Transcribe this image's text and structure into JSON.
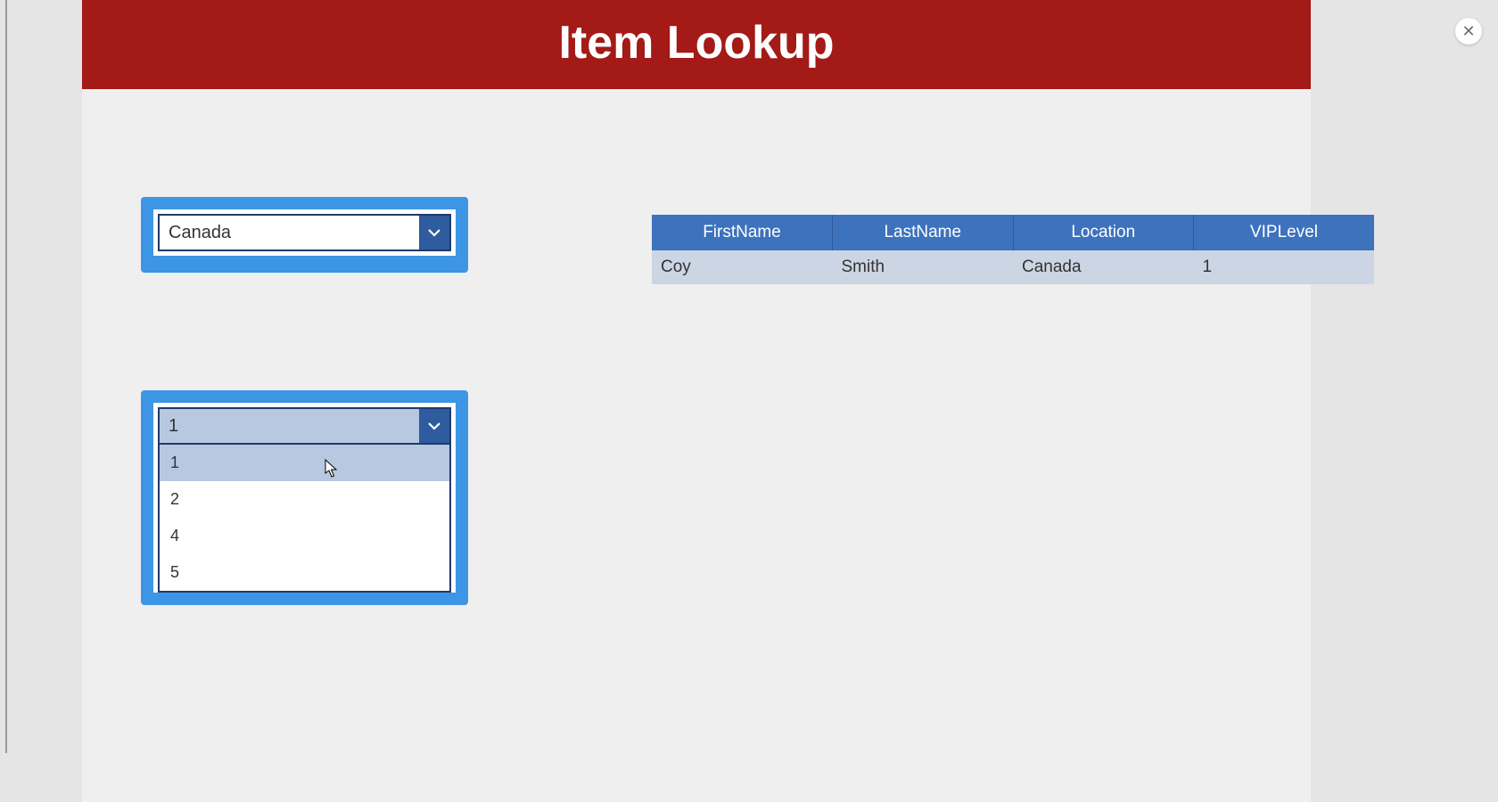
{
  "header": {
    "title": "Item Lookup"
  },
  "close": {
    "glyph": "✕"
  },
  "location_dropdown": {
    "value": "Canada"
  },
  "vip_dropdown": {
    "value": "1",
    "options": [
      "1",
      "2",
      "4",
      "5"
    ],
    "highlighted_index": 0
  },
  "table": {
    "headers": [
      "FirstName",
      "LastName",
      "Location",
      "VIPLevel"
    ],
    "rows": [
      {
        "FirstName": "Coy",
        "LastName": "Smith",
        "Location": "Canada",
        "VIPLevel": "1"
      }
    ]
  }
}
